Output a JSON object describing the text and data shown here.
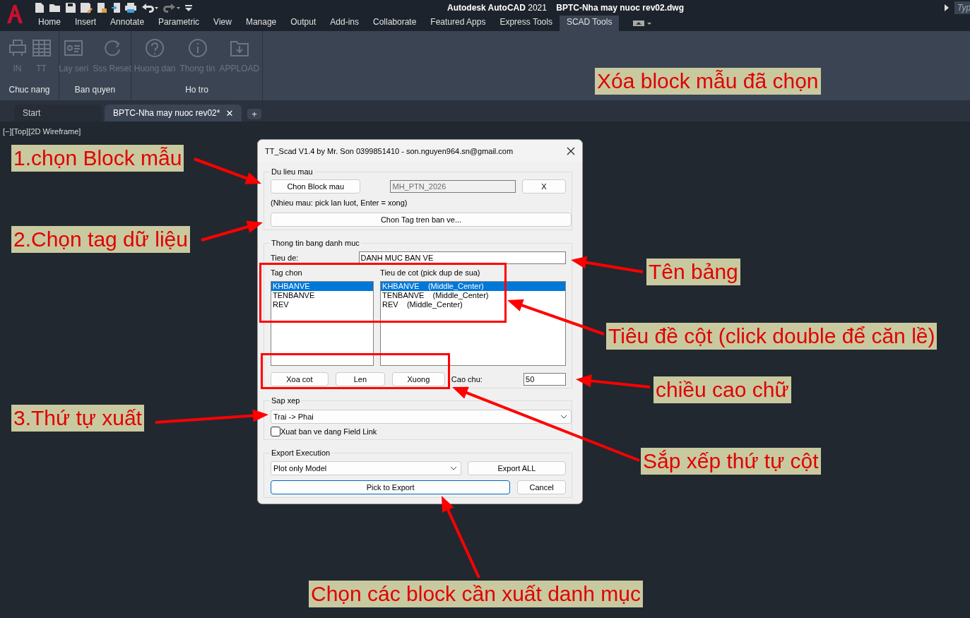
{
  "app": {
    "title": "**Autodesk AutoCAD** 2021",
    "document": "BPTC-Nha may nuoc rev02.dwg",
    "search_placeholder": "Typ"
  },
  "ribbon_tabs": [
    {
      "label": "Home",
      "selected": false
    },
    {
      "label": "Insert",
      "selected": false
    },
    {
      "label": "Annotate",
      "selected": false
    },
    {
      "label": "Parametric",
      "selected": false
    },
    {
      "label": "View",
      "selected": false
    },
    {
      "label": "Manage",
      "selected": false
    },
    {
      "label": "Output",
      "selected": false
    },
    {
      "label": "Add-ins",
      "selected": false
    },
    {
      "label": "Collaborate",
      "selected": false
    },
    {
      "label": "Featured Apps",
      "selected": false
    },
    {
      "label": "Express Tools",
      "selected": false
    },
    {
      "label": "SCAD Tools",
      "selected": true
    }
  ],
  "ribbon_panels": [
    {
      "title": "Chuc nang",
      "tools": [
        {
          "label": "IN",
          "kind": "printer",
          "disabled": true
        },
        {
          "label": "TT",
          "kind": "table",
          "disabled": true
        }
      ]
    },
    {
      "title": "Ban quyen",
      "tools": [
        {
          "label": "Lay seri",
          "kind": "card",
          "disabled": true
        },
        {
          "label": "Sss Reset",
          "kind": "reset",
          "disabled": true
        }
      ]
    },
    {
      "title": "Ho tro",
      "tools": [
        {
          "label": "Huong dan",
          "kind": "help",
          "disabled": true
        },
        {
          "label": "Thong tin",
          "kind": "info",
          "disabled": true
        },
        {
          "label": "APPLOAD",
          "kind": "folder",
          "disabled": true
        }
      ]
    }
  ],
  "doc_tabs": [
    {
      "label": "Start",
      "selected": false
    },
    {
      "label": "BPTC-Nha may nuoc rev02*",
      "selected": true,
      "close": "✕"
    }
  ],
  "new_tab": "+",
  "viewport_label": "[−][Top][2D Wireframe]",
  "dialog": {
    "title": "TT_Scad V1.4 by Mr. Son 0399851410 - son.nguyen964.sn@gmail.com",
    "sample_group": {
      "legend": "Du lieu mau",
      "pick_button": "Chon Block mau",
      "block_name": "MH_PTN_2026",
      "clear_button": "X",
      "hint": "(Nhieu mau: pick lan luot, Enter = xong)",
      "tag_button": "Chon Tag tren ban ve..."
    },
    "table_group": {
      "legend": "Thong tin bang danh muc",
      "title_label": "Tieu de:",
      "title_value": "DANH MUC BAN VE",
      "tags_label": "Tag chon",
      "columns_label": "Tieu de cot (pick dup de sua)",
      "tags": [
        {
          "text": "KHBANVE",
          "selected": true
        },
        {
          "text": "TENBANVE",
          "selected": false
        },
        {
          "text": "REV",
          "selected": false
        }
      ],
      "columns": [
        {
          "text": "KHBANVE    (Middle_Center)",
          "selected": true
        },
        {
          "text": "TENBANVE    (Middle_Center)",
          "selected": false
        },
        {
          "text": "REV    (Middle_Center)",
          "selected": false
        }
      ],
      "buttons": [
        "Xoa cot",
        "Len",
        "Xuong"
      ],
      "height_label": "Cao chu:",
      "height_value": "50"
    },
    "sort_group": {
      "legend": "Sap xep",
      "order": "Trai -> Phai",
      "field_link": {
        "label": "Xuat ban ve dang Field Link",
        "checked": false
      }
    },
    "export_group": {
      "legend": "Export Execution",
      "mode": "Plot only Model",
      "export_all": "Export ALL",
      "pick": "Pick to Export",
      "cancel": "Cancel"
    }
  },
  "annotations": [
    {
      "text": "Xóa block mẫu đã chọn"
    },
    {
      "text": "1.chọn Block mẫu"
    },
    {
      "text": "2.Chọn tag dữ liệu"
    },
    {
      "text": "Tên bảng"
    },
    {
      "text": "Tiêu đề cột (click double để căn lề)"
    },
    {
      "text": "chiều cao chữ"
    },
    {
      "text": "3.Thứ tự xuất"
    },
    {
      "text": "Sắp xếp thứ tự cột"
    },
    {
      "text": "Chọn các block cần xuất danh mục"
    }
  ]
}
